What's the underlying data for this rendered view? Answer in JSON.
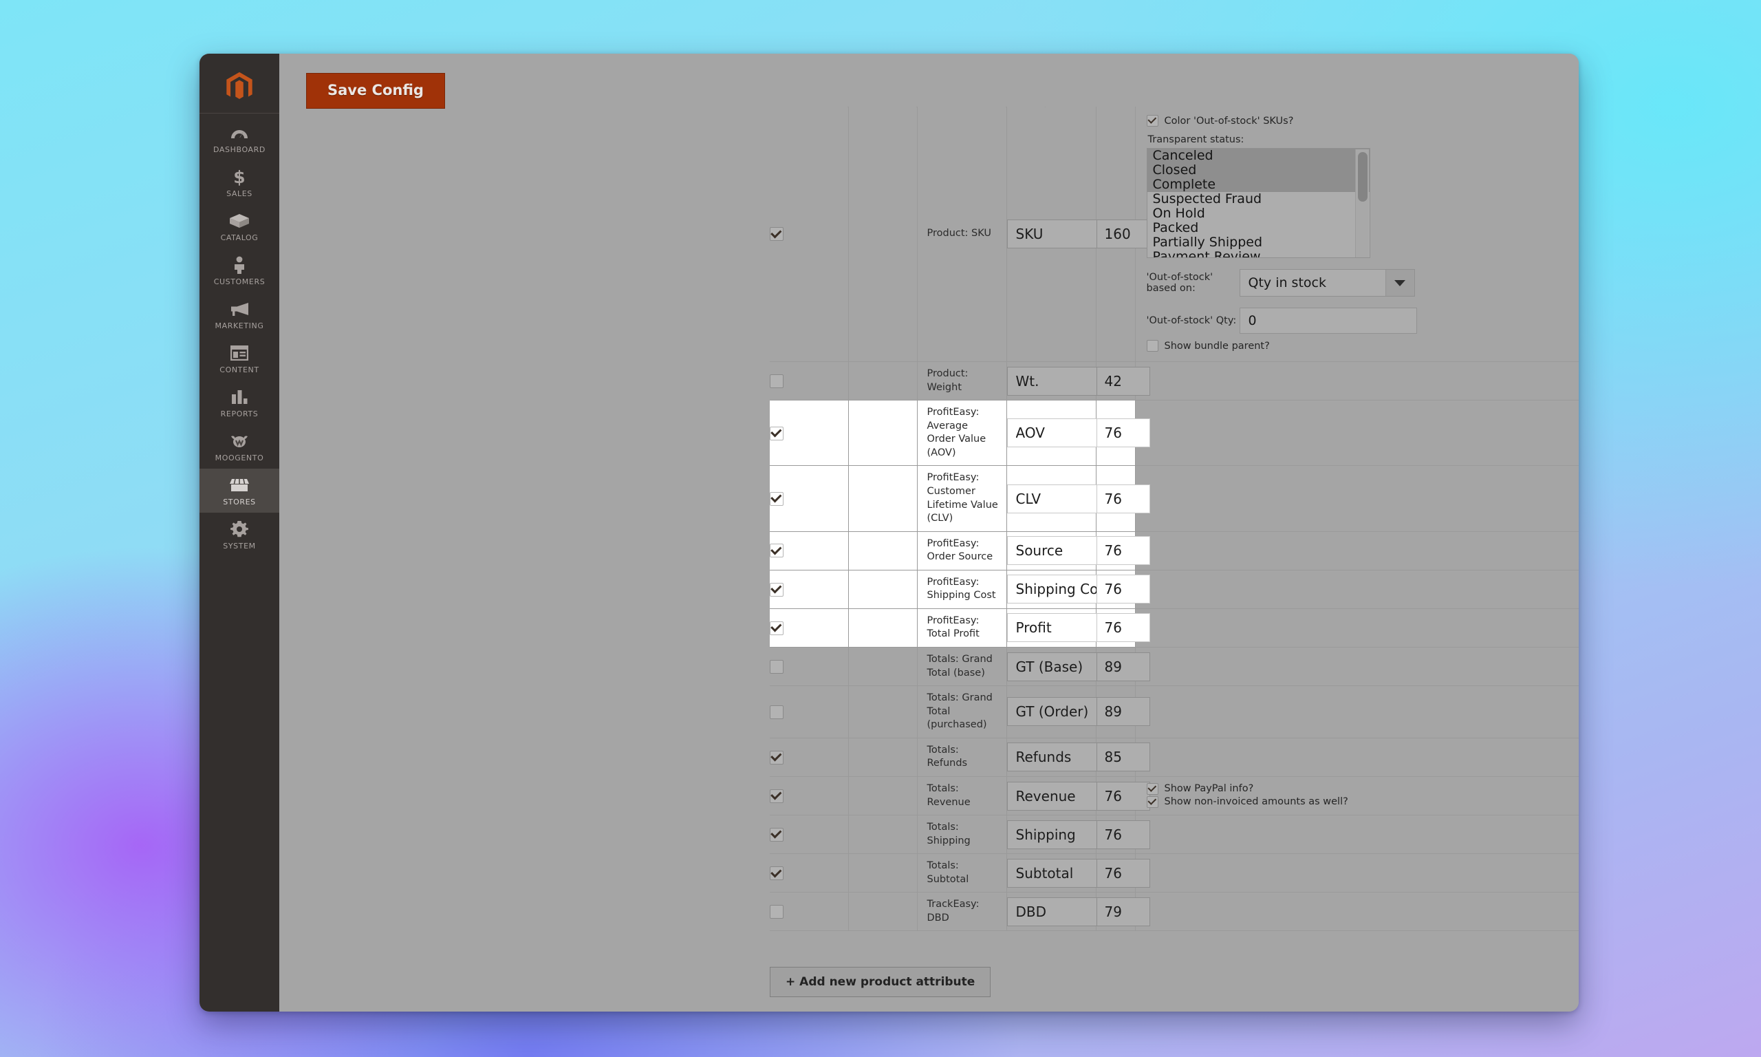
{
  "app": {
    "logo_icon": "magento-logo-icon",
    "save_config_label": "Save Config",
    "add_attribute_label": "+ Add new product attribute"
  },
  "sidebar": {
    "items": [
      {
        "label": "DASHBOARD",
        "icon": "dashboard-gauge-icon",
        "active": false
      },
      {
        "label": "SALES",
        "icon": "dollar-sign-icon",
        "active": false
      },
      {
        "label": "CATALOG",
        "icon": "box-icon",
        "active": false
      },
      {
        "label": "CUSTOMERS",
        "icon": "person-icon",
        "active": false
      },
      {
        "label": "MARKETING",
        "icon": "megaphone-icon",
        "active": false
      },
      {
        "label": "CONTENT",
        "icon": "layout-icon",
        "active": false
      },
      {
        "label": "REPORTS",
        "icon": "bar-chart-icon",
        "active": false
      },
      {
        "label": "MOOGENTO",
        "icon": "moogento-cow-icon",
        "active": false
      },
      {
        "label": "STORES",
        "icon": "storefront-icon",
        "active": true
      },
      {
        "label": "SYSTEM",
        "icon": "gear-icon",
        "active": false
      }
    ]
  },
  "table": {
    "rows": [
      {
        "enabled": true,
        "attribute": "Product: SKU",
        "title": "SKU",
        "width": "160",
        "highlighted": false,
        "extra": "sku"
      },
      {
        "enabled": false,
        "attribute": "Product: Weight",
        "title": "Wt.",
        "width": "42",
        "highlighted": false,
        "extra": ""
      },
      {
        "enabled": true,
        "attribute": "ProfitEasy: Average Order Value (AOV)",
        "title": "AOV",
        "width": "76",
        "highlighted": true,
        "extra": ""
      },
      {
        "enabled": true,
        "attribute": "ProfitEasy: Customer Lifetime Value (CLV)",
        "title": "CLV",
        "width": "76",
        "highlighted": true,
        "extra": ""
      },
      {
        "enabled": true,
        "attribute": "ProfitEasy: Order Source",
        "title": "Source",
        "width": "76",
        "highlighted": true,
        "extra": ""
      },
      {
        "enabled": true,
        "attribute": "ProfitEasy: Shipping Cost",
        "title": "Shipping Cost",
        "width": "76",
        "highlighted": true,
        "extra": ""
      },
      {
        "enabled": true,
        "attribute": "ProfitEasy: Total Profit",
        "title": "Profit",
        "width": "76",
        "highlighted": true,
        "extra": ""
      },
      {
        "enabled": false,
        "attribute": "Totals: Grand Total (base)",
        "title": "GT (Base)",
        "width": "89",
        "highlighted": false,
        "extra": ""
      },
      {
        "enabled": false,
        "attribute": "Totals: Grand Total (purchased)",
        "title": "GT (Order)",
        "width": "89",
        "highlighted": false,
        "extra": ""
      },
      {
        "enabled": true,
        "attribute": "Totals: Refunds",
        "title": "Refunds",
        "width": "85",
        "highlighted": false,
        "extra": ""
      },
      {
        "enabled": true,
        "attribute": "Totals: Revenue",
        "title": "Revenue",
        "width": "76",
        "highlighted": false,
        "extra": "revenue"
      },
      {
        "enabled": true,
        "attribute": "Totals: Shipping",
        "title": "Shipping",
        "width": "76",
        "highlighted": false,
        "extra": ""
      },
      {
        "enabled": true,
        "attribute": "Totals: Subtotal",
        "title": "Subtotal",
        "width": "76",
        "highlighted": false,
        "extra": ""
      },
      {
        "enabled": false,
        "attribute": "TrackEasy: DBD",
        "title": "DBD",
        "width": "79",
        "highlighted": false,
        "extra": ""
      }
    ]
  },
  "sku_options": {
    "color_oos_label": "Color 'Out-of-stock' SKUs?",
    "color_oos_checked": true,
    "transparent_status_label": "Transparent status:",
    "status_options": [
      {
        "label": "Canceled",
        "selected": true
      },
      {
        "label": "Closed",
        "selected": true
      },
      {
        "label": "Complete",
        "selected": true
      },
      {
        "label": "Suspected Fraud",
        "selected": false
      },
      {
        "label": "On Hold",
        "selected": false
      },
      {
        "label": "Packed",
        "selected": false
      },
      {
        "label": "Partially Shipped",
        "selected": false
      },
      {
        "label": "Payment Review",
        "selected": false
      }
    ],
    "based_on_label": "'Out-of-stock' based on:",
    "based_on_value": "Qty in stock",
    "oos_qty_label": "'Out-of-stock' Qty:",
    "oos_qty_value": "0",
    "bundle_parent_label": "Show bundle parent?",
    "bundle_parent_checked": false
  },
  "revenue_options": {
    "paypal_label": "Show PayPal info?",
    "paypal_checked": true,
    "non_invoiced_label": "Show non-invoiced amounts as well?",
    "non_invoiced_checked": true
  },
  "colors": {
    "accent": "#a03208",
    "sidebar_bg": "#332f2d",
    "page_bg": "#a5a5a5",
    "highlight_row": "#ffffff"
  }
}
